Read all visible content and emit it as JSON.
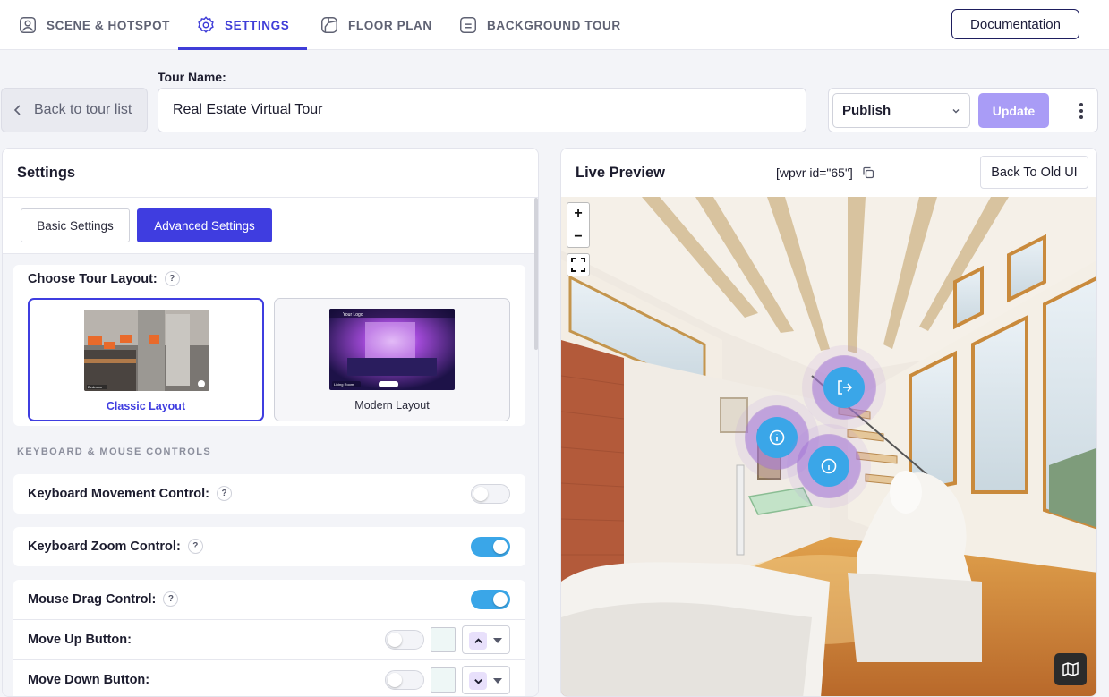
{
  "nav": {
    "tabs": [
      {
        "label": "SCENE & HOTSPOT",
        "icon": "scene-icon"
      },
      {
        "label": "SETTINGS",
        "icon": "gear-icon"
      },
      {
        "label": "FLOOR PLAN",
        "icon": "floor-plan-icon"
      },
      {
        "label": "BACKGROUND TOUR",
        "icon": "background-tour-icon"
      }
    ],
    "active_tab": "SETTINGS",
    "documentation_label": "Documentation"
  },
  "toolbar": {
    "back_label": "Back to tour list",
    "tour_name_label": "Tour Name:",
    "tour_name_value": "Real Estate Virtual Tour",
    "status_selected": "Publish",
    "update_label": "Update"
  },
  "settings": {
    "title": "Settings",
    "basic_tab": "Basic Settings",
    "advanced_tab": "Advanced Settings",
    "layout_label": "Choose Tour Layout:",
    "layouts": [
      {
        "name": "Classic Layout",
        "selected": true
      },
      {
        "name": "Modern Layout",
        "selected": false
      }
    ],
    "modern_thumb_text": {
      "logo": "Your Logo",
      "room": "Living Room"
    },
    "classic_thumb_text": {
      "room": "Bedroom"
    },
    "section_keyboard_mouse": "KEYBOARD & MOUSE CONTROLS",
    "controls": [
      {
        "label": "Keyboard Movement Control:",
        "enabled": false
      },
      {
        "label": "Keyboard Zoom Control:",
        "enabled": true
      },
      {
        "label": "Mouse Drag Control:",
        "enabled": true
      }
    ],
    "buttons": [
      {
        "label": "Move Up Button:",
        "enabled": false,
        "icon": "chevron-up-icon"
      },
      {
        "label": "Move Down Button:",
        "enabled": false,
        "icon": "chevron-down-icon"
      }
    ],
    "help_glyph": "?"
  },
  "preview": {
    "title": "Live Preview",
    "shortcode": "[wpvr id=\"65\"]",
    "old_ui_label": "Back To Old UI",
    "zoom_in": "+",
    "zoom_out": "−",
    "hotspot_icons": [
      "exit-icon",
      "info-icon",
      "info-icon"
    ]
  },
  "colors": {
    "accent": "#3f3de0",
    "toggle_on": "#3aa6e8",
    "update_disabled": "#a99cf6"
  }
}
